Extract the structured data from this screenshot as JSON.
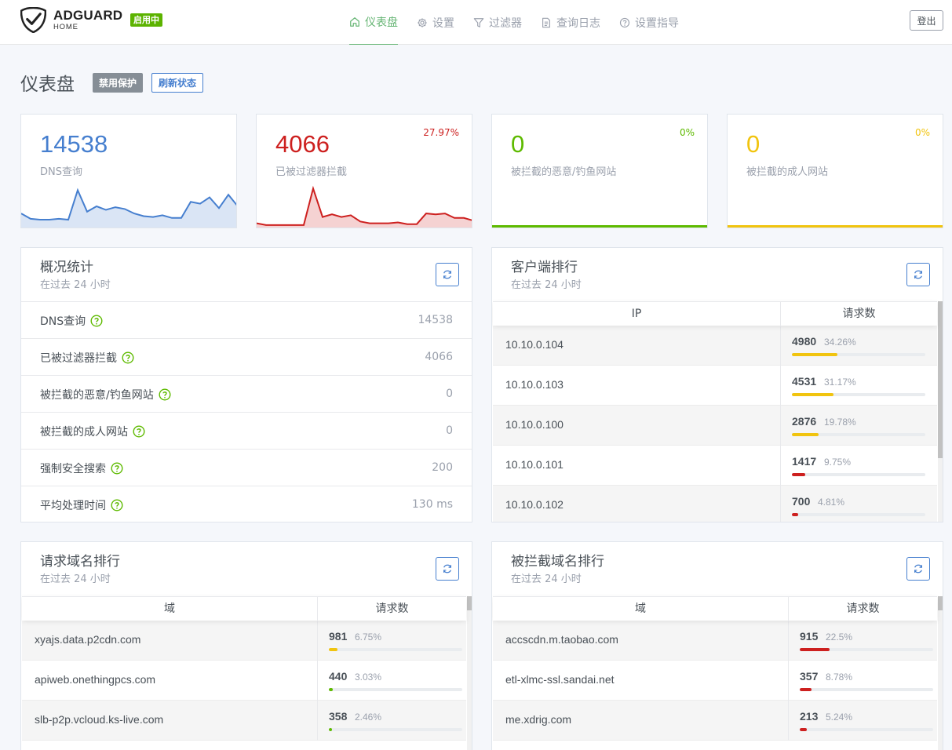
{
  "brand": {
    "name": "ADGUARD",
    "sub": "HOME",
    "status": "启用中"
  },
  "nav": [
    {
      "label": "仪表盘",
      "icon": "home-icon",
      "active": true
    },
    {
      "label": "设置",
      "icon": "gear-icon"
    },
    {
      "label": "过滤器",
      "icon": "filter-icon"
    },
    {
      "label": "查询日志",
      "icon": "document-icon"
    },
    {
      "label": "设置指导",
      "icon": "help-circle-icon"
    }
  ],
  "logout": "登出",
  "page": {
    "title": "仪表盘",
    "disable_btn": "禁用保护",
    "refresh_btn": "刷新状态"
  },
  "colors": {
    "blue": "#467fcf",
    "red": "#cd201f",
    "green": "#5eba00",
    "yellow": "#f1c40f",
    "nav_active": "#66b574"
  },
  "stats": [
    {
      "value": "14538",
      "label": "DNS查询",
      "percent": "",
      "color": "#467fcf",
      "spark": [
        14,
        8,
        7,
        7,
        8,
        7,
        40,
        16,
        22,
        18,
        21,
        19,
        14,
        11,
        10,
        12,
        9,
        9,
        27,
        25,
        32,
        20,
        35,
        22
      ]
    },
    {
      "value": "4066",
      "label": "已被过滤器拦截",
      "percent": "27.97%",
      "color": "#cd201f",
      "spark": [
        3,
        1,
        1,
        1,
        1,
        1,
        42,
        10,
        13,
        10,
        12,
        5,
        3,
        3,
        3,
        4,
        2,
        2,
        14,
        13,
        14,
        9,
        9,
        6
      ]
    },
    {
      "value": "0",
      "label": "被拦截的恶意/钓鱼网站",
      "percent": "0%",
      "color": "#5eba00"
    },
    {
      "value": "0",
      "label": "被拦截的成人网站",
      "percent": "0%",
      "color": "#f1c40f"
    }
  ],
  "overview": {
    "title": "概况统计",
    "subtitle": "在过去 24 小时",
    "rows": [
      {
        "label": "DNS查询",
        "value": "14538"
      },
      {
        "label": "已被过滤器拦截",
        "value": "4066"
      },
      {
        "label": "被拦截的恶意/钓鱼网站",
        "value": "0"
      },
      {
        "label": "被拦截的成人网站",
        "value": "0"
      },
      {
        "label": "强制安全搜索",
        "value": "200"
      },
      {
        "label": "平均处理时间",
        "value": "130 ms"
      }
    ]
  },
  "clients": {
    "title": "客户端排行",
    "subtitle": "在过去 24 小时",
    "col1": "IP",
    "col2": "请求数",
    "rows": [
      {
        "name": "10.10.0.104",
        "count": "4980",
        "pct": "34.26%",
        "fill": 0.3426,
        "color": "#f1c40f"
      },
      {
        "name": "10.10.0.103",
        "count": "4531",
        "pct": "31.17%",
        "fill": 0.3117,
        "color": "#f1c40f"
      },
      {
        "name": "10.10.0.100",
        "count": "2876",
        "pct": "19.78%",
        "fill": 0.1978,
        "color": "#f1c40f"
      },
      {
        "name": "10.10.0.101",
        "count": "1417",
        "pct": "9.75%",
        "fill": 0.0975,
        "color": "#cd201f"
      },
      {
        "name": "10.10.0.102",
        "count": "700",
        "pct": "4.81%",
        "fill": 0.0481,
        "color": "#cd201f"
      }
    ]
  },
  "queried": {
    "title": "请求域名排行",
    "subtitle": "在过去 24 小时",
    "col1": "域",
    "col2": "请求数",
    "rows": [
      {
        "name": "xyajs.data.p2cdn.com",
        "count": "981",
        "pct": "6.75%",
        "fill": 0.0675,
        "color": "#f1c40f"
      },
      {
        "name": "apiweb.onethingpcs.com",
        "count": "440",
        "pct": "3.03%",
        "fill": 0.0303,
        "color": "#5eba00"
      },
      {
        "name": "slb-p2p.vcloud.ks-live.com",
        "count": "358",
        "pct": "2.46%",
        "fill": 0.0246,
        "color": "#5eba00"
      }
    ]
  },
  "blocked": {
    "title": "被拦截域名排行",
    "subtitle": "在过去 24 小时",
    "col1": "域",
    "col2": "请求数",
    "rows": [
      {
        "name": "accscdn.m.taobao.com",
        "count": "915",
        "pct": "22.5%",
        "fill": 0.225,
        "color": "#cd201f"
      },
      {
        "name": "etl-xlmc-ssl.sandai.net",
        "count": "357",
        "pct": "8.78%",
        "fill": 0.0878,
        "color": "#cd201f"
      },
      {
        "name": "me.xdrig.com",
        "count": "213",
        "pct": "5.24%",
        "fill": 0.0524,
        "color": "#cd201f"
      }
    ]
  }
}
